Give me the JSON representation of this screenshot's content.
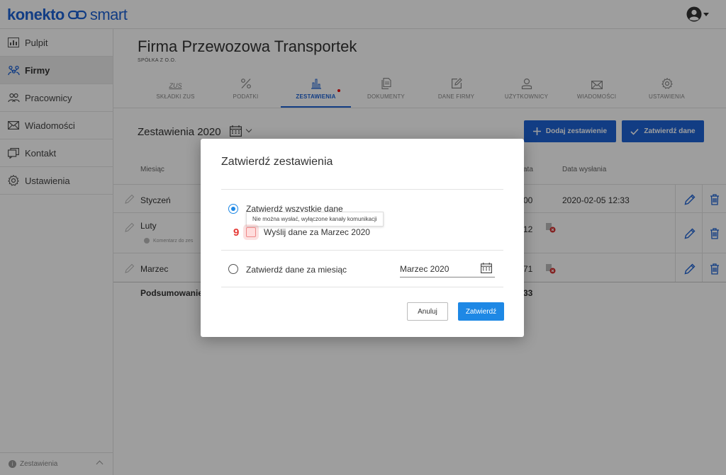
{
  "brand": {
    "part1": "konekto",
    "part2": "smart"
  },
  "sidebar": {
    "items": [
      {
        "label": "Pulpit",
        "icon": "dashboard-icon"
      },
      {
        "label": "Firmy",
        "icon": "companies-icon",
        "active": true
      },
      {
        "label": "Pracownicy",
        "icon": "employees-icon"
      },
      {
        "label": "Wiadomości",
        "icon": "envelope-icon"
      },
      {
        "label": "Kontakt",
        "icon": "contact-icon"
      },
      {
        "label": "Ustawienia",
        "icon": "gear-icon"
      }
    ],
    "footer": "Zestawienia"
  },
  "company": {
    "name": "Firma Przewozowa Transportek",
    "type": "SPÓŁKA Z O.O."
  },
  "tabs": [
    {
      "label": "SKŁADKI ZUS",
      "icon": "zus-icon"
    },
    {
      "label": "PODATKI",
      "icon": "percent-icon"
    },
    {
      "label": "ZESTAWIENIA",
      "icon": "bar-chart-icon",
      "active": true
    },
    {
      "label": "DOKUMENTY",
      "icon": "documents-icon"
    },
    {
      "label": "DANE FIRMY",
      "icon": "edit-icon"
    },
    {
      "label": "UŻYTKOWNICY",
      "icon": "user-icon"
    },
    {
      "label": "WIADOMOŚCI",
      "icon": "envelope-icon"
    },
    {
      "label": "USTAWIENIA",
      "icon": "gear-icon"
    }
  ],
  "zus_icon_text": "ZUS",
  "section": {
    "title": "Zestawienia 2020",
    "add_label": "Dodaj zestawienie",
    "confirm_label": "Zatwierdź dane"
  },
  "table": {
    "headers": {
      "month": "Miesiąc",
      "data_col_fragment": "ata",
      "sent": "Data wysłania"
    },
    "rows": [
      {
        "month": "Styczeń",
        "value_fragment": "00",
        "sent": "2020-02-05 12:33"
      },
      {
        "month": "Luty",
        "value_fragment": "12",
        "comment": "Komentarz do zes"
      },
      {
        "month": "Marzec",
        "value_fragment": "71"
      }
    ],
    "summary": {
      "label": "Podsumowanie",
      "value_fragment": "33"
    }
  },
  "modal": {
    "title": "Zatwierdź zestawienia",
    "option_all": "Zatwierdź wszystkie dane",
    "tooltip": "Nie można wysłać, wyłączone kanały komunikacji",
    "step_number": "9",
    "send_label": "Wyślij dane za Marzec 2020",
    "option_month": "Zatwierdź dane za miesiąc",
    "month_value": "Marzec 2020",
    "cancel": "Anuluj",
    "ok": "Zatwierdź"
  },
  "colors": {
    "primary": "#1e63d6",
    "accent": "#1e88e5",
    "error": "#e53935"
  }
}
